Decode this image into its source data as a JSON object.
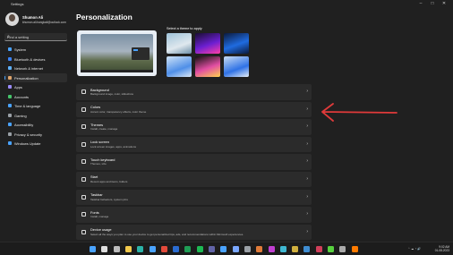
{
  "window": {
    "title": "Settings"
  },
  "profile": {
    "name": "Shumon Ali",
    "email": "khumon.ali.bangladi@outlook.com"
  },
  "search": {
    "placeholder": "Find a setting"
  },
  "sidebar": {
    "items": [
      {
        "label": "System",
        "color": "#4aa3ff"
      },
      {
        "label": "Bluetooth & devices",
        "color": "#3b82f6"
      },
      {
        "label": "Network & internet",
        "color": "#5fb3ff"
      },
      {
        "label": "Personalization",
        "color": "#e0a56b",
        "selected": true
      },
      {
        "label": "Apps",
        "color": "#9b8cff"
      },
      {
        "label": "Accounts",
        "color": "#45c46a"
      },
      {
        "label": "Time & language",
        "color": "#4aa3ff"
      },
      {
        "label": "Gaming",
        "color": "#9aa0a6"
      },
      {
        "label": "Accessibility",
        "color": "#4aa3ff"
      },
      {
        "label": "Privacy & security",
        "color": "#9aa0a6"
      },
      {
        "label": "Windows Update",
        "color": "#4aa3ff"
      }
    ]
  },
  "main": {
    "heading": "Personalization",
    "themes_label": "Select a theme to apply",
    "themes": [
      {
        "name": "theme-light-lake",
        "bg": "linear-gradient(160deg,#9fc3d9,#dfe8ee 60%,#6d8fa8)"
      },
      {
        "name": "theme-dark-glow",
        "bg": "linear-gradient(160deg,#1a0d33,#6b1fd1 55%,#ff3fa8)"
      },
      {
        "name": "theme-dark-bloom",
        "bg": "linear-gradient(160deg,#0b1a3d,#1f6be0 55%,#0b1a3d)"
      },
      {
        "name": "theme-light-bloom",
        "bg": "linear-gradient(160deg,#cfe3f7,#4f8fe8 60%,#dbe8f6)"
      },
      {
        "name": "theme-flower",
        "bg": "linear-gradient(160deg,#111,#e24ea3 55%,#ffd34e)"
      },
      {
        "name": "theme-blue-bloom",
        "bg": "linear-gradient(160deg,#c9ddf5,#2f72e6 60%,#e6eef8)"
      }
    ],
    "settings": [
      {
        "title": "Background",
        "sub": "Background image, color, slideshow"
      },
      {
        "title": "Colors",
        "sub": "Accent color, transparency effects, color theme"
      },
      {
        "title": "Themes",
        "sub": "Install, create, manage"
      },
      {
        "title": "Lock screen",
        "sub": "Lock screen images, apps, animations"
      },
      {
        "title": "Touch keyboard",
        "sub": "Themes, size"
      },
      {
        "title": "Start",
        "sub": "Recent apps and items, folders"
      },
      {
        "title": "Taskbar",
        "sub": "Taskbar behaviors, system pins"
      },
      {
        "title": "Fonts",
        "sub": "Install, manage"
      },
      {
        "title": "Device usage",
        "sub": "Select all the ways you plan to use your device to get personalized tips, ads, and recommendations within Microsoft experiences."
      }
    ]
  },
  "annotation": {
    "arrow_color": "#e03a3a"
  },
  "taskbar": {
    "time": "9:02 AM",
    "date": "01-08-2023",
    "apps": [
      {
        "name": "start",
        "color": "#4aa3ff"
      },
      {
        "name": "search",
        "color": "#ddd"
      },
      {
        "name": "taskview",
        "color": "#bbb"
      },
      {
        "name": "explorer",
        "color": "#f2c94c"
      },
      {
        "name": "edge",
        "color": "#2bb3a8"
      },
      {
        "name": "store",
        "color": "#4aa3ff"
      },
      {
        "name": "chrome",
        "color": "#e24a3b"
      },
      {
        "name": "word",
        "color": "#2b6cd1"
      },
      {
        "name": "excel",
        "color": "#1f9d55"
      },
      {
        "name": "spotify",
        "color": "#1db954"
      },
      {
        "name": "teams",
        "color": "#6264a7"
      },
      {
        "name": "mail",
        "color": "#4aa3ff"
      },
      {
        "name": "photos",
        "color": "#7aa7ff"
      },
      {
        "name": "settings",
        "color": "#9aa0a6"
      },
      {
        "name": "app",
        "color": "#e07b39"
      },
      {
        "name": "app2",
        "color": "#c13fd1"
      },
      {
        "name": "app3",
        "color": "#3fb7d1"
      },
      {
        "name": "app4",
        "color": "#d1b03f"
      },
      {
        "name": "app5",
        "color": "#3f8dd1"
      },
      {
        "name": "app6",
        "color": "#d13f5a"
      },
      {
        "name": "app7",
        "color": "#58d13f"
      },
      {
        "name": "app8",
        "color": "#aaa"
      },
      {
        "name": "app9",
        "color": "#ff7b00"
      }
    ]
  }
}
